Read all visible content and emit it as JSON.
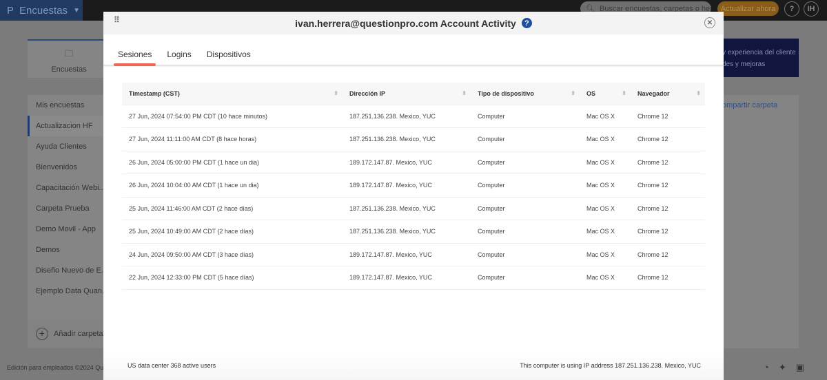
{
  "app": {
    "brand": "Encuestas",
    "search_placeholder": "Buscar encuestas, carpetas o herrami",
    "update_label": "Actualizar ahora",
    "help": "?",
    "avatar": "IH"
  },
  "background": {
    "card_label": "Encuestas",
    "banner_line1": "y experiencia del cliente",
    "banner_line2": "des y mejoras",
    "share_link": "ompartir carpeta",
    "folders": [
      "Mis encuestas",
      "Actualizacion HF",
      "Ayuda Clientes",
      "Bienvenidos",
      "Capacitación Webi...",
      "Carpeta Prueba",
      "Demo Movil - App",
      "Demos",
      "Diseño Nuevo de E...",
      "Ejemplo Data Quan..."
    ],
    "add_folder": "Añadir carpeta",
    "footer": "Edición para empleados ©2024 Qu"
  },
  "modal": {
    "title": "ivan.herrera@questionpro.com Account Activity",
    "help": "?",
    "tabs": [
      "Sesiones",
      "Logins",
      "Dispositivos"
    ],
    "active_tab": "Sesiones",
    "columns": [
      "Timestamp (CST)",
      "Dirección IP",
      "Tipo de dispositivo",
      "OS",
      "Navegador"
    ],
    "rows": [
      [
        "27 Jun, 2024 07:54:00 PM CDT (10 hace minutos)",
        "187.251.136.238. Mexico, YUC",
        "Computer",
        "Mac OS X",
        "Chrome 12"
      ],
      [
        "27 Jun, 2024 11:11:00 AM CDT (8 hace horas)",
        "187.251.136.238. Mexico, YUC",
        "Computer",
        "Mac OS X",
        "Chrome 12"
      ],
      [
        "26 Jun, 2024 05:00:00 PM CDT (1 hace un dia)",
        "189.172.147.87. Mexico, YUC",
        "Computer",
        "Mac OS X",
        "Chrome 12"
      ],
      [
        "26 Jun, 2024 10:04:00 AM CDT (1 hace un dia)",
        "189.172.147.87. Mexico, YUC",
        "Computer",
        "Mac OS X",
        "Chrome 12"
      ],
      [
        "25 Jun, 2024 11:46:00 AM CDT (2 hace días)",
        "187.251.136.238. Mexico, YUC",
        "Computer",
        "Mac OS X",
        "Chrome 12"
      ],
      [
        "25 Jun, 2024 10:49:00 AM CDT (2 hace días)",
        "187.251.136.238. Mexico, YUC",
        "Computer",
        "Mac OS X",
        "Chrome 12"
      ],
      [
        "24 Jun, 2024 09:50:00 AM CDT (3 hace días)",
        "189.172.147.87. Mexico, YUC",
        "Computer",
        "Mac OS X",
        "Chrome 12"
      ],
      [
        "22 Jun, 2024 12:33:00 PM CDT (5 hace días)",
        "189.172.147.87. Mexico, YUC",
        "Computer",
        "Mac OS X",
        "Chrome 12"
      ]
    ],
    "footer_left": "US data center 368 active users",
    "footer_right": "This computer is using IP address 187.251.136.238. Mexico, YUC"
  }
}
